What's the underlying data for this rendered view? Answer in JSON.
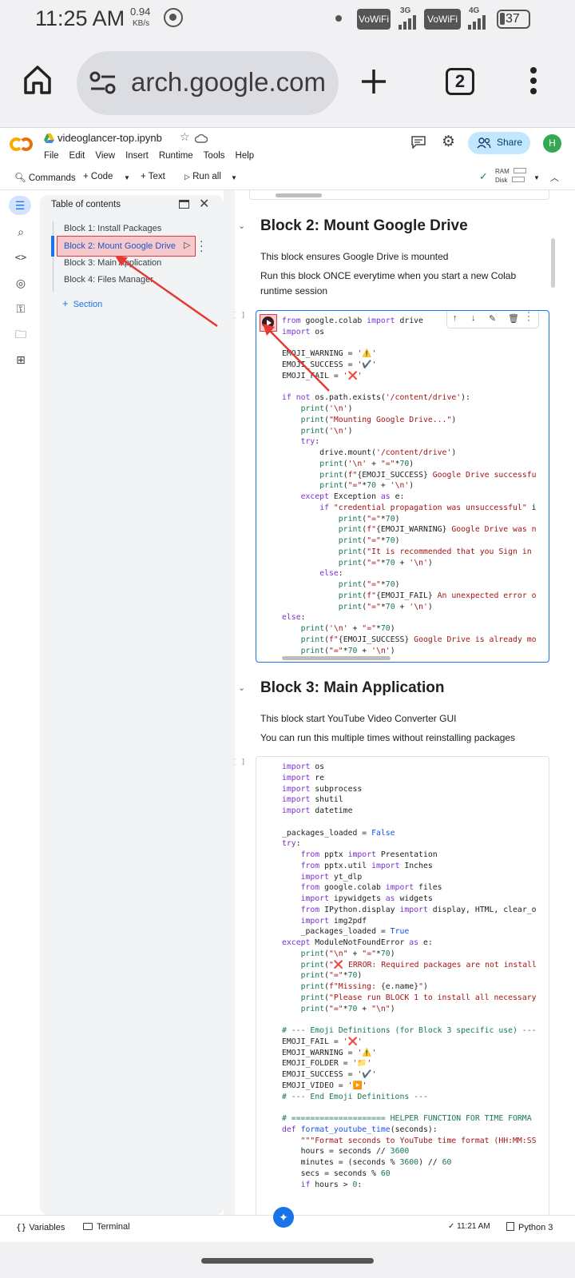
{
  "status_bar": {
    "time": "11:25 AM",
    "speed_value": "0.94",
    "speed_unit": "KB/s",
    "vowifi_1": "VoWiFi",
    "net_1": "3G",
    "vowifi_2": "VoWiFi",
    "net_2": "4G",
    "battery": "37"
  },
  "browser": {
    "url": "arch.google.com",
    "tab_count": "2"
  },
  "colab": {
    "notebook_title": "videoglancer-top.ipynb",
    "menu": [
      "File",
      "Edit",
      "View",
      "Insert",
      "Runtime",
      "Tools",
      "Help"
    ],
    "share_label": "Share",
    "avatar_letter": "H",
    "toolbar": {
      "commands": "Commands",
      "code": "+ Code",
      "text": "+ Text",
      "run_all": "Run all",
      "ram": "RAM",
      "disk": "Disk"
    }
  },
  "toc": {
    "title": "Table of contents",
    "items": [
      "Block 1: Install Packages",
      "Block 2: Mount Google Drive",
      "Block 3: Main Application",
      "Block 4: Files Manager"
    ],
    "add_section": "Section"
  },
  "notebook": {
    "block2_title": "Block 2: Mount Google Drive",
    "block2_p1": "This block ensures Google Drive is mounted",
    "block2_p2": "Run this block ONCE everytime when you start a new Colab runtime session",
    "block3_title": "Block 3: Main Application",
    "block3_p1": "This block start YouTube Video Converter GUI",
    "block3_p2": "You can run this multiple times without reinstalling packages",
    "cell_bracket": "[ ]"
  },
  "bottom_bar": {
    "variables": "Variables",
    "terminal": "Terminal",
    "time": "11:21 AM",
    "kernel": "Python 3"
  },
  "colors": {
    "accent_blue": "#1a73e8",
    "highlight_red": "#e53935",
    "toc_highlight_bg": "#f8c9cc",
    "share_bg": "#c2e7ff",
    "avatar_green": "#34a853"
  }
}
